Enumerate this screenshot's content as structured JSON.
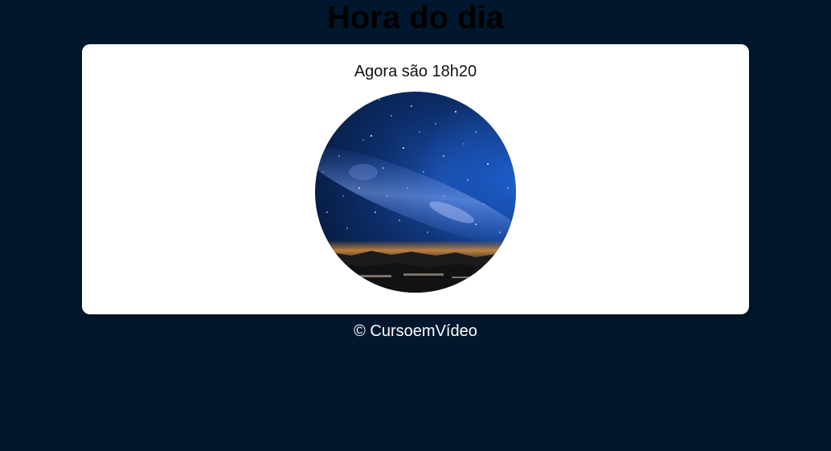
{
  "header": {
    "title": "Hora do dia"
  },
  "main": {
    "time_message": "Agora são 18h20",
    "image": {
      "subject": "night-sky-image"
    }
  },
  "footer": {
    "copyright": "© CursoemVídeo"
  },
  "colors": {
    "background": "#00172d",
    "card": "#ffffff",
    "footer_text": "#ffffff"
  }
}
